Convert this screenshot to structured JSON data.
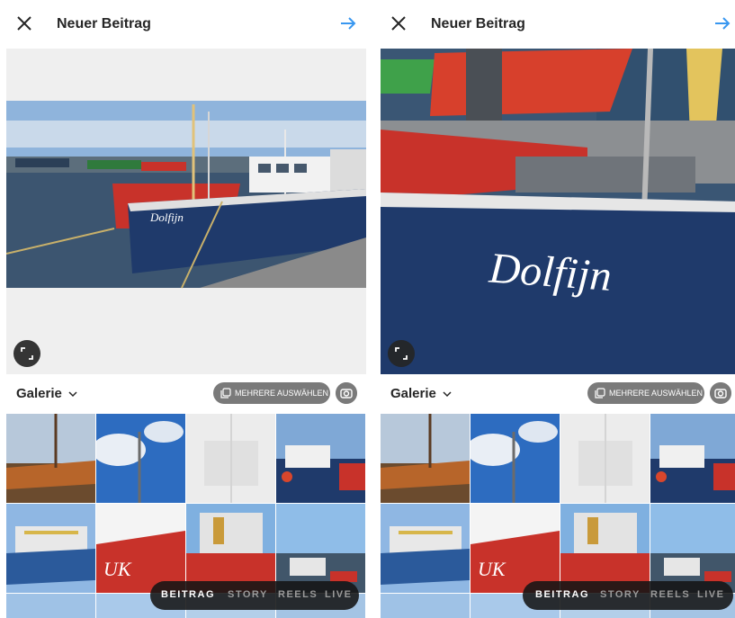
{
  "screens": [
    {
      "header": {
        "title": "Neuer Beitrag"
      },
      "boat_name": "Dolfijn",
      "gallery": {
        "title": "Galerie",
        "multi_select_label": "MEHRERE AUSWÄHLEN"
      },
      "modes": [
        "BEITRAG",
        "STORY",
        "REELS",
        "LIVE"
      ],
      "active_mode": "BEITRAG"
    },
    {
      "header": {
        "title": "Neuer Beitrag"
      },
      "boat_name": "Dolfijn",
      "gallery": {
        "title": "Galerie",
        "multi_select_label": "MEHRERE AUSWÄHLEN"
      },
      "modes": [
        "BEITRAG",
        "STORY",
        "REELS",
        "LIVE"
      ],
      "active_mode": "BEITRAG"
    }
  ],
  "colors": {
    "accent": "#3897f0",
    "text": "#262626",
    "hull": "#1f3a6b",
    "red_hull": "#c8322a"
  },
  "icons": [
    "close-icon",
    "arrow-right-icon",
    "expand-icon",
    "chevron-down-icon",
    "multiple-select-icon",
    "camera-icon"
  ]
}
